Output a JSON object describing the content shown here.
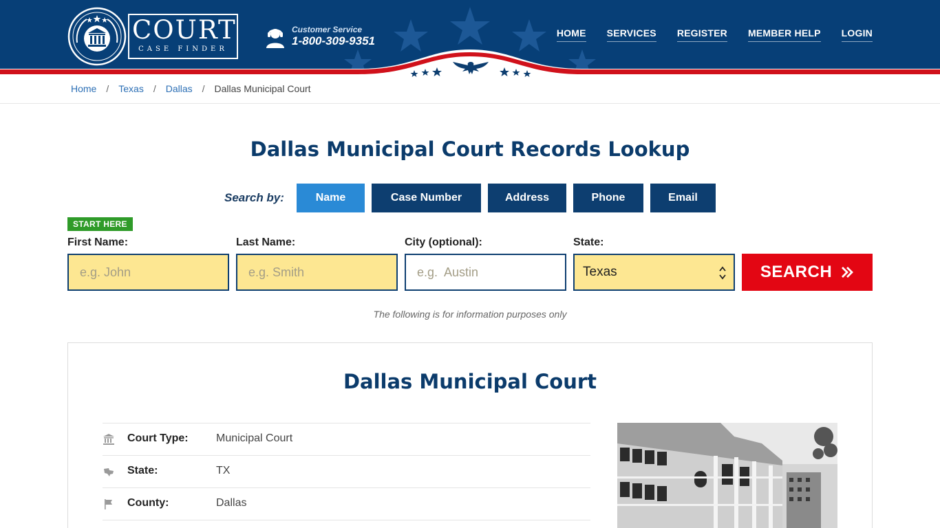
{
  "header": {
    "logo_title": "COURT",
    "logo_subtitle": "CASE FINDER",
    "customer_service_label": "Customer Service",
    "customer_service_phone": "1-800-309-9351",
    "nav": [
      {
        "label": "HOME"
      },
      {
        "label": "SERVICES"
      },
      {
        "label": "REGISTER"
      },
      {
        "label": "MEMBER HELP"
      },
      {
        "label": "LOGIN"
      }
    ],
    "colors": {
      "primary": "#073f77",
      "accent_red": "#d0111b"
    }
  },
  "breadcrumb": {
    "items": [
      "Home",
      "Texas",
      "Dallas"
    ],
    "current": "Dallas Municipal Court",
    "separator": "/"
  },
  "page_title": "Dallas Municipal Court Records Lookup",
  "search": {
    "search_by_label": "Search by:",
    "tabs": [
      {
        "label": "Name",
        "active": true
      },
      {
        "label": "Case Number",
        "active": false
      },
      {
        "label": "Address",
        "active": false
      },
      {
        "label": "Phone",
        "active": false
      },
      {
        "label": "Email",
        "active": false
      }
    ],
    "start_here": "START HERE",
    "fields": {
      "first_name": {
        "label": "First Name:",
        "placeholder": "e.g. John",
        "value": ""
      },
      "last_name": {
        "label": "Last Name:",
        "placeholder": "e.g. Smith",
        "value": ""
      },
      "city": {
        "label": "City (optional):",
        "placeholder": "e.g.  Austin",
        "value": ""
      },
      "state": {
        "label": "State:",
        "value": "Texas"
      }
    },
    "button_label": "SEARCH",
    "note": "The following is for information purposes only"
  },
  "court": {
    "title": "Dallas Municipal Court",
    "rows": [
      {
        "icon": "courthouse-icon",
        "label": "Court Type:",
        "value": "Municipal Court"
      },
      {
        "icon": "state-map-icon",
        "label": "State:",
        "value": "TX"
      },
      {
        "icon": "flag-icon",
        "label": "County:",
        "value": "Dallas"
      }
    ]
  }
}
